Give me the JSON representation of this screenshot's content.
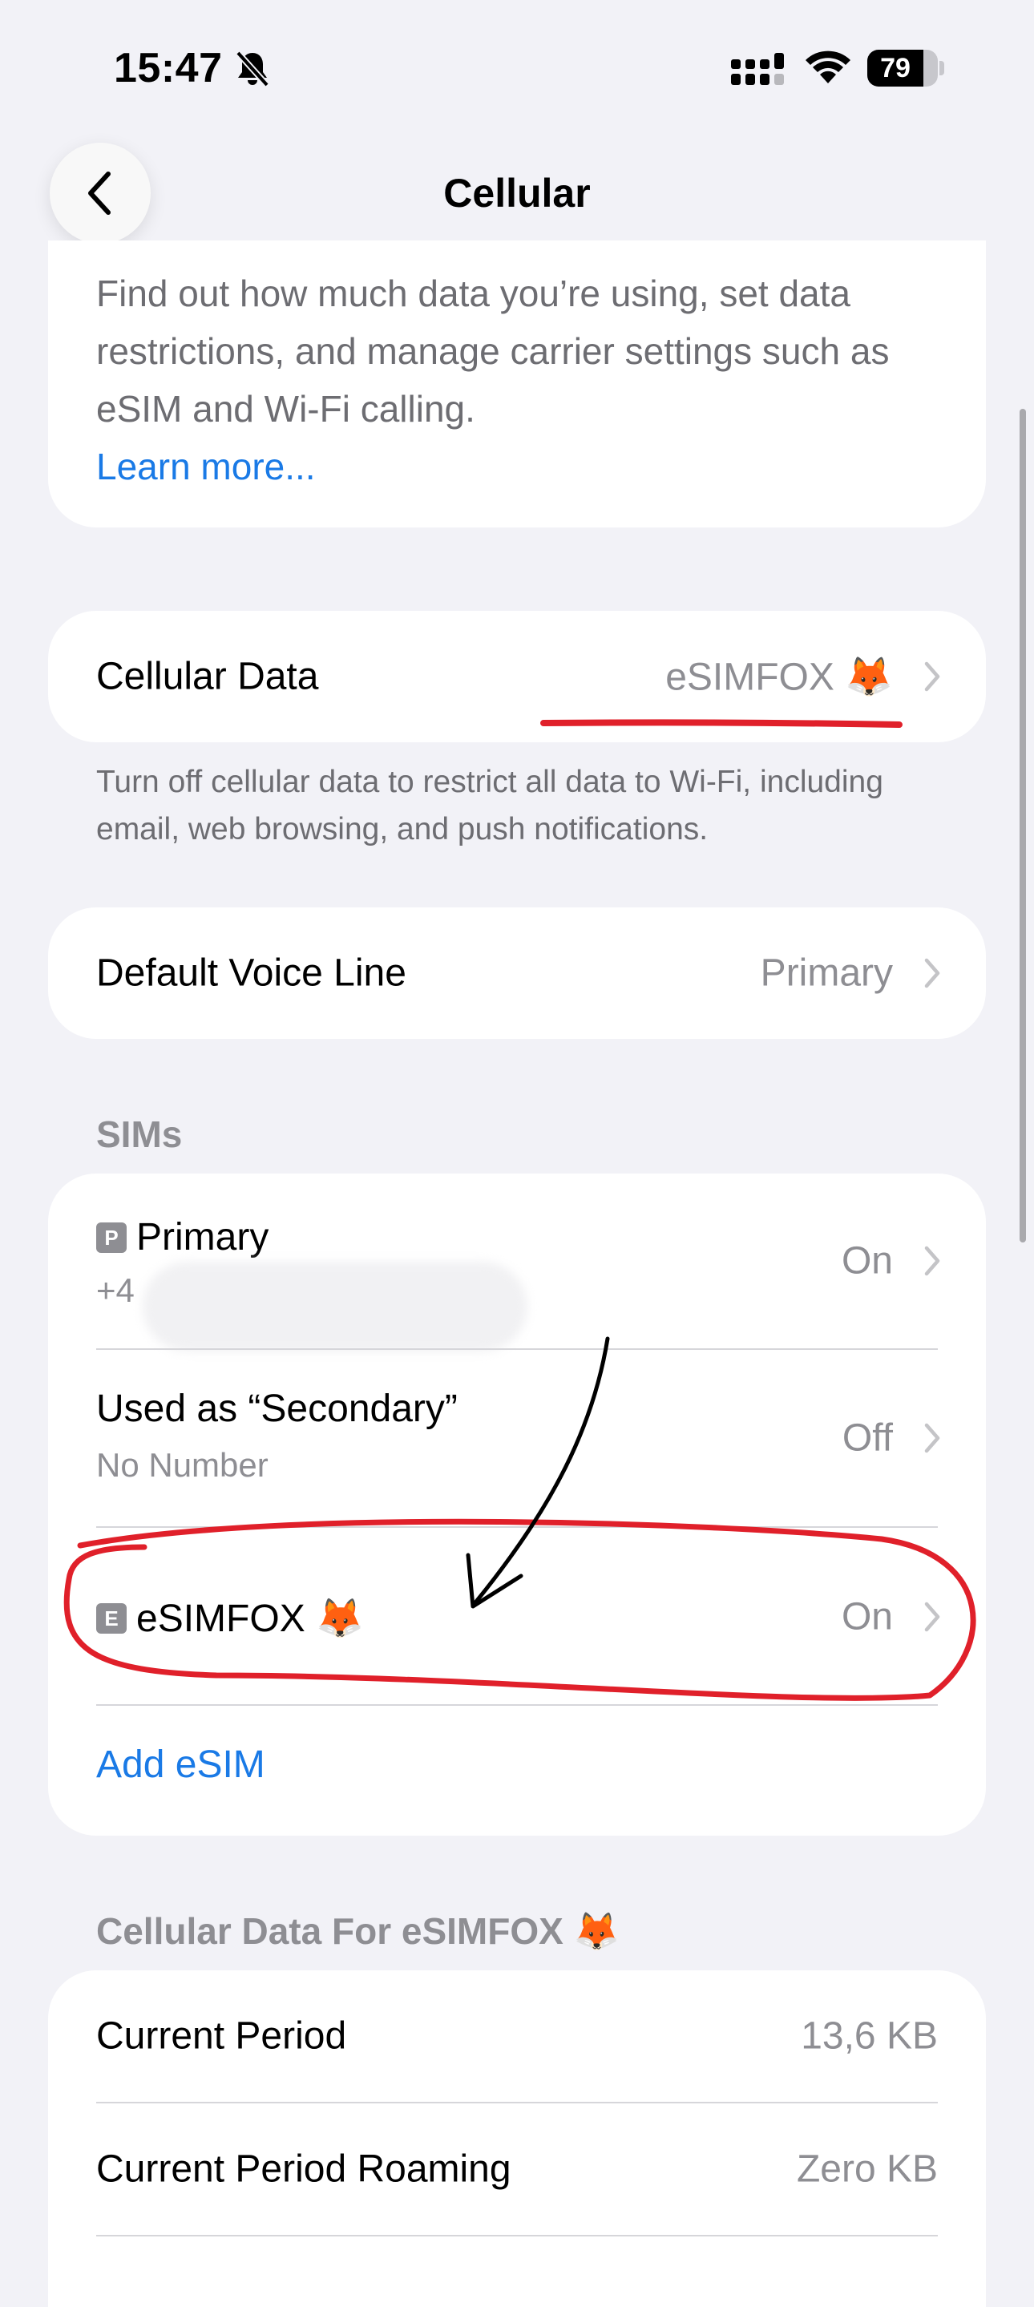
{
  "status_bar": {
    "time": "15:47",
    "battery_level": 79,
    "battery_text": "79",
    "icons": [
      "bell-slash-icon",
      "cellular-signal-icon",
      "wifi-icon",
      "battery-icon"
    ]
  },
  "nav": {
    "title": "Cellular",
    "back_icon": "chevron-left-icon"
  },
  "intro": {
    "text": "Find out how much data you’re using, set data restrictions, and manage carrier settings such as eSIM and Wi-Fi calling.",
    "learn_more": "Learn more..."
  },
  "cellular_data": {
    "label": "Cellular Data",
    "value": "eSIMFOX 🦊",
    "footnote": "Turn off cellular data to restrict all data to Wi-Fi, including email, web browsing, and push notifications."
  },
  "default_voice_line": {
    "label": "Default Voice Line",
    "value": "Primary"
  },
  "sims": {
    "header": "SIMs",
    "items": [
      {
        "badge": "P",
        "title": "Primary",
        "subtitle": "+4",
        "status": "On"
      },
      {
        "badge": "",
        "title": "Used as “Secondary”",
        "subtitle": "No Number",
        "status": "Off"
      },
      {
        "badge": "E",
        "title": "eSIMFOX 🦊",
        "subtitle": "",
        "status": "On"
      }
    ],
    "add_esim": "Add eSIM"
  },
  "usage": {
    "header": "Cellular Data For eSIMFOX 🦊",
    "rows": [
      {
        "label": "Current Period",
        "value": "13,6 KB"
      },
      {
        "label": "Current Period Roaming",
        "value": "Zero KB"
      }
    ]
  },
  "colors": {
    "background": "#f2f2f7",
    "link": "#1a7ae6",
    "annotation": "#e0202a",
    "secondary_text": "#8e8e93"
  }
}
